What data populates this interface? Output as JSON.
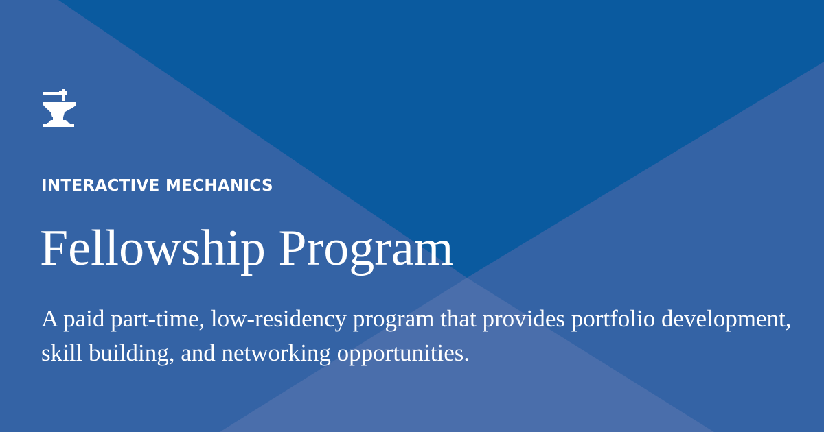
{
  "brand": {
    "name": "INTERACTIVE MECHANICS",
    "logo_icon": "anvil-icon"
  },
  "hero": {
    "title": "Fellowship Program",
    "description": "A paid part-time, low-residency program that provides portfolio development, skill building, and networking opportunities."
  },
  "colors": {
    "background": "#3463a5",
    "panel_dark": "#0a5a9f",
    "panel_light": "#4a6eab",
    "text": "#ffffff"
  }
}
